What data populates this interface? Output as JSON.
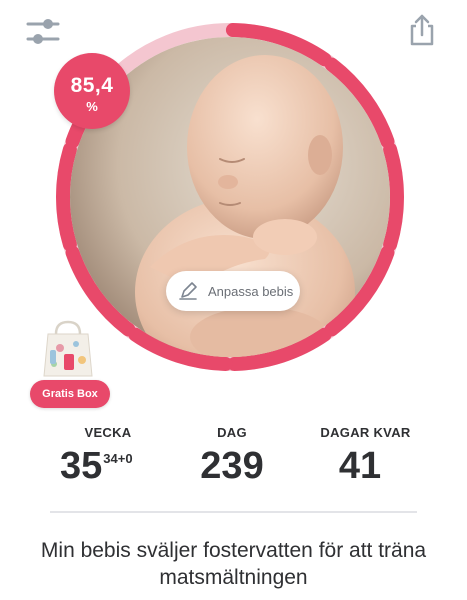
{
  "progress": {
    "percent_value": "85,4",
    "percent_unit": "%",
    "fraction": 0.854
  },
  "colors": {
    "accent": "#e8496a",
    "accent_light": "#f4c6d0",
    "text": "#2f3033",
    "icon": "#9aa3ad"
  },
  "icons": {
    "settings": "sliders-icon",
    "share": "share-icon",
    "edit": "pencil-icon",
    "gift": "gift-bag-icon"
  },
  "customize": {
    "label": "Anpassa bebis"
  },
  "gratis_box": {
    "label": "Gratis Box"
  },
  "stats": {
    "week": {
      "label": "VECKA",
      "value": "35",
      "sub": "34+0"
    },
    "day": {
      "label": "DAG",
      "value": "239"
    },
    "days_left": {
      "label": "DAGAR KVAR",
      "value": "41"
    }
  },
  "fact": {
    "text": "Min bebis sväljer fostervatten för att träna matsmältningen"
  }
}
